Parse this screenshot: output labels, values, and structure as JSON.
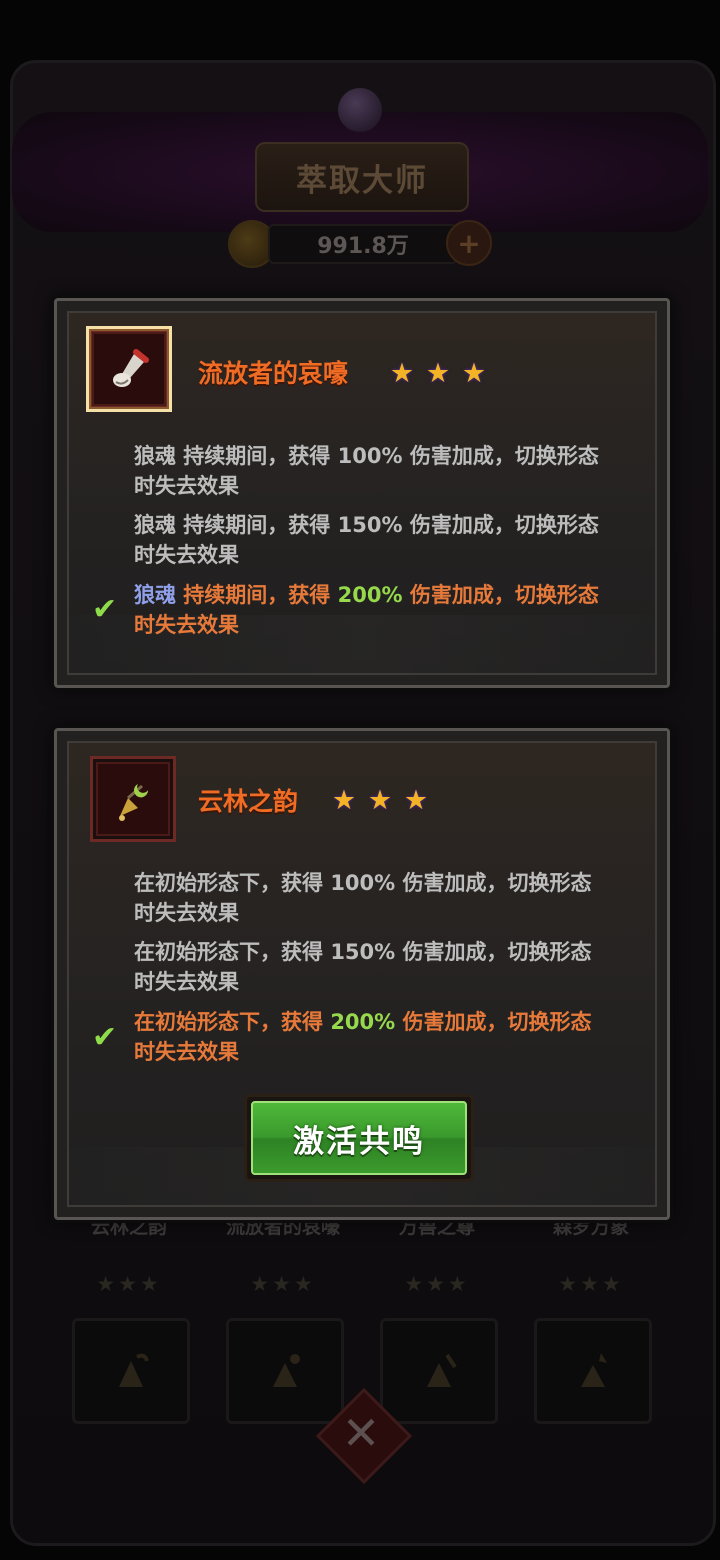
{
  "header": {
    "title": "萃取大师",
    "currency_amount": "991.8万",
    "plus_symbol": "+"
  },
  "background_tabs": [
    {
      "name": "云林之韵",
      "stars": "★★★"
    },
    {
      "name": "流放者的哀嚎",
      "stars": "★★★"
    },
    {
      "name": "万兽之尊",
      "stars": "★★★"
    },
    {
      "name": "森罗万象",
      "stars": "★★★"
    }
  ],
  "cards": [
    {
      "name": "流放者的哀嚎",
      "stars": 3,
      "tiers": [
        {
          "keyword": "狼魂",
          "prefix": " 持续期间，获得 ",
          "percent": "100%",
          "suffix": " 伤害加成，切换形态时失去效果",
          "active": false
        },
        {
          "keyword": "狼魂",
          "prefix": " 持续期间，获得 ",
          "percent": "150%",
          "suffix": " 伤害加成，切换形态时失去效果",
          "active": false
        },
        {
          "keyword": "狼魂",
          "prefix": " 持续期间，获得 ",
          "percent": "200%",
          "suffix": " 伤害加成，切换形态时失去效果",
          "active": true
        }
      ]
    },
    {
      "name": "云林之韵",
      "stars": 3,
      "tiers": [
        {
          "prefix": "在初始形态下，获得 ",
          "percent": "100%",
          "suffix": " 伤害加成，切换形态时失去效果",
          "active": false
        },
        {
          "prefix": "在初始形态下，获得 ",
          "percent": "150%",
          "suffix": " 伤害加成，切换形态时失去效果",
          "active": false
        },
        {
          "prefix": "在初始形态下，获得 ",
          "percent": "200%",
          "suffix": " 伤害加成，切换形态时失去效果",
          "active": true
        }
      ]
    }
  ],
  "star_glyph": "★",
  "check_glyph": "✔",
  "activate_button": {
    "label": "激活共鸣"
  },
  "close_glyph": "✕",
  "colors": {
    "accent_orange": "#f06b23",
    "highlight_green": "#97d94c",
    "keyword_blue": "#8fa0e8",
    "button_green": "#3a9a2c"
  }
}
